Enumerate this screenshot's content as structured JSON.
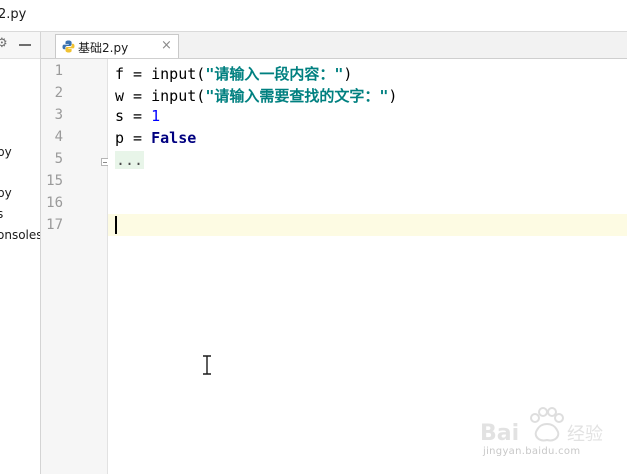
{
  "window": {
    "title": "2.py"
  },
  "project_panel": {
    "items": [
      "py",
      "py",
      "s",
      "onsoles"
    ]
  },
  "tabs": [
    {
      "label": "基础2.py",
      "close": "×"
    }
  ],
  "editor": {
    "line_numbers": [
      "1",
      "2",
      "3",
      "4",
      "5",
      "15",
      "16",
      "17"
    ],
    "lines": [
      {
        "var": "f",
        "op": " = ",
        "func": "input",
        "open": "(",
        "str": "\"请输入一段内容：\"",
        "close": ")"
      },
      {
        "var": "w",
        "op": " = ",
        "func": "input",
        "open": "(",
        "str": "\"请输入需要查找的文字：\"",
        "close": ")"
      },
      {
        "var": "s",
        "op": " = ",
        "num": "1"
      },
      {
        "var": "p",
        "op": " = ",
        "kw": "False"
      },
      {
        "folded": "..."
      }
    ],
    "current_line": "17"
  },
  "watermark": {
    "text": "jingyan.baidu.com",
    "logo": "Baidu经验"
  }
}
